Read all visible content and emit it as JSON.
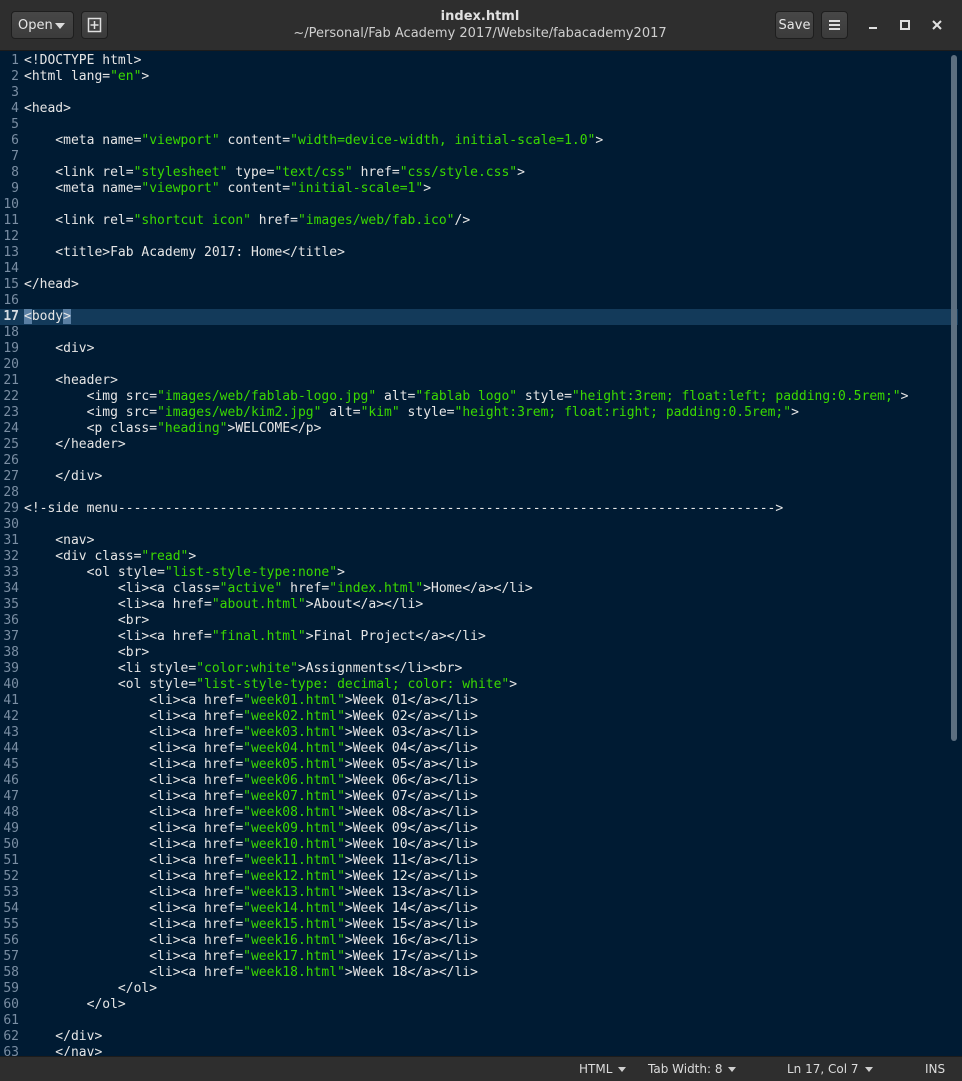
{
  "titlebar": {
    "open_label": "Open",
    "save_label": "Save",
    "title": "index.html",
    "subtitle": "~/Personal/Fab Academy 2017/Website/fabacademy2017",
    "icons": [
      "new-document-icon",
      "hamburger-menu-icon",
      "minimize-icon",
      "maximize-icon",
      "close-icon"
    ]
  },
  "colors": {
    "background": "#001b33",
    "string": "#3ad900",
    "text": "#e6e6e6",
    "current_line": "#133a5a"
  },
  "editor": {
    "current_line": 17,
    "lines": [
      [
        [
          "t",
          "<!DOCTYPE html>"
        ]
      ],
      [
        [
          "t",
          "<html lang="
        ],
        [
          "s",
          "\"en\""
        ],
        [
          "t",
          ">"
        ]
      ],
      [],
      [
        [
          "t",
          "<head>"
        ]
      ],
      [],
      [
        [
          "t",
          "    <meta name="
        ],
        [
          "s",
          "\"viewport\""
        ],
        [
          "t",
          " content="
        ],
        [
          "s",
          "\"width=device-width, initial-scale=1.0\""
        ],
        [
          "t",
          ">"
        ]
      ],
      [],
      [
        [
          "t",
          "    <link rel="
        ],
        [
          "s",
          "\"stylesheet\""
        ],
        [
          "t",
          " type="
        ],
        [
          "s",
          "\"text/css\""
        ],
        [
          "t",
          " href="
        ],
        [
          "s",
          "\"css/style.css\""
        ],
        [
          "t",
          ">"
        ]
      ],
      [
        [
          "t",
          "    <meta name="
        ],
        [
          "s",
          "\"viewport\""
        ],
        [
          "t",
          " content="
        ],
        [
          "s",
          "\"initial-scale=1\""
        ],
        [
          "t",
          ">"
        ]
      ],
      [],
      [
        [
          "t",
          "    <link rel="
        ],
        [
          "s",
          "\"shortcut icon\""
        ],
        [
          "t",
          " href="
        ],
        [
          "s",
          "\"images/web/fab.ico\""
        ],
        [
          "t",
          "/>"
        ]
      ],
      [],
      [
        [
          "t",
          "    <title>Fab Academy 2017: Home</title>"
        ]
      ],
      [],
      [
        [
          "t",
          "</head>"
        ]
      ],
      [],
      [
        [
          "sel",
          "<"
        ],
        [
          "t",
          "body"
        ],
        [
          "sel",
          ">"
        ]
      ],
      [],
      [
        [
          "t",
          "    <div>"
        ]
      ],
      [],
      [
        [
          "t",
          "    <header>"
        ]
      ],
      [
        [
          "t",
          "        <img src="
        ],
        [
          "s",
          "\"images/web/fablab-logo.jpg\""
        ],
        [
          "t",
          " alt="
        ],
        [
          "s",
          "\"fablab logo\""
        ],
        [
          "t",
          " style="
        ],
        [
          "s",
          "\"height:3rem; float:left; padding:0.5rem;\""
        ],
        [
          "t",
          ">"
        ]
      ],
      [
        [
          "t",
          "        <img src="
        ],
        [
          "s",
          "\"images/web/kim2.jpg\""
        ],
        [
          "t",
          " alt="
        ],
        [
          "s",
          "\"kim\""
        ],
        [
          "t",
          " style="
        ],
        [
          "s",
          "\"height:3rem; float:right; padding:0.5rem;\""
        ],
        [
          "t",
          ">"
        ]
      ],
      [
        [
          "t",
          "        <p class="
        ],
        [
          "s",
          "\"heading\""
        ],
        [
          "t",
          ">WELCOME</p>"
        ]
      ],
      [
        [
          "t",
          "    </header>"
        ]
      ],
      [],
      [
        [
          "t",
          "    </div>"
        ]
      ],
      [],
      [
        [
          "t",
          "<!-side menu------------------------------------------------------------------------------------>"
        ]
      ],
      [],
      [
        [
          "t",
          "    <nav>"
        ]
      ],
      [
        [
          "t",
          "    <div class="
        ],
        [
          "s",
          "\"read\""
        ],
        [
          "t",
          ">"
        ]
      ],
      [
        [
          "t",
          "        <ol style="
        ],
        [
          "s",
          "\"list-style-type:none\""
        ],
        [
          "t",
          ">"
        ]
      ],
      [
        [
          "t",
          "            <li><a class="
        ],
        [
          "s",
          "\"active\""
        ],
        [
          "t",
          " href="
        ],
        [
          "s",
          "\"index.html\""
        ],
        [
          "t",
          ">Home</a></li>"
        ]
      ],
      [
        [
          "t",
          "            <li><a href="
        ],
        [
          "s",
          "\"about.html\""
        ],
        [
          "t",
          ">About</a></li>"
        ]
      ],
      [
        [
          "t",
          "            <br>"
        ]
      ],
      [
        [
          "t",
          "            <li><a href="
        ],
        [
          "s",
          "\"final.html\""
        ],
        [
          "t",
          ">Final Project</a></li>"
        ]
      ],
      [
        [
          "t",
          "            <br>"
        ]
      ],
      [
        [
          "t",
          "            <li style="
        ],
        [
          "s",
          "\"color:white\""
        ],
        [
          "t",
          ">Assignments</li><br>"
        ]
      ],
      [
        [
          "t",
          "            <ol style="
        ],
        [
          "s",
          "\"list-style-type: decimal; color: white\""
        ],
        [
          "t",
          ">"
        ]
      ],
      [
        [
          "t",
          "                <li><a href="
        ],
        [
          "s",
          "\"week01.html\""
        ],
        [
          "t",
          ">Week 01</a></li>"
        ]
      ],
      [
        [
          "t",
          "                <li><a href="
        ],
        [
          "s",
          "\"week02.html\""
        ],
        [
          "t",
          ">Week 02</a></li>"
        ]
      ],
      [
        [
          "t",
          "                <li><a href="
        ],
        [
          "s",
          "\"week03.html\""
        ],
        [
          "t",
          ">Week 03</a></li>"
        ]
      ],
      [
        [
          "t",
          "                <li><a href="
        ],
        [
          "s",
          "\"week04.html\""
        ],
        [
          "t",
          ">Week 04</a></li>"
        ]
      ],
      [
        [
          "t",
          "                <li><a href="
        ],
        [
          "s",
          "\"week05.html\""
        ],
        [
          "t",
          ">Week 05</a></li>"
        ]
      ],
      [
        [
          "t",
          "                <li><a href="
        ],
        [
          "s",
          "\"week06.html\""
        ],
        [
          "t",
          ">Week 06</a></li>"
        ]
      ],
      [
        [
          "t",
          "                <li><a href="
        ],
        [
          "s",
          "\"week07.html\""
        ],
        [
          "t",
          ">Week 07</a></li>"
        ]
      ],
      [
        [
          "t",
          "                <li><a href="
        ],
        [
          "s",
          "\"week08.html\""
        ],
        [
          "t",
          ">Week 08</a></li>"
        ]
      ],
      [
        [
          "t",
          "                <li><a href="
        ],
        [
          "s",
          "\"week09.html\""
        ],
        [
          "t",
          ">Week 09</a></li>"
        ]
      ],
      [
        [
          "t",
          "                <li><a href="
        ],
        [
          "s",
          "\"week10.html\""
        ],
        [
          "t",
          ">Week 10</a></li>"
        ]
      ],
      [
        [
          "t",
          "                <li><a href="
        ],
        [
          "s",
          "\"week11.html\""
        ],
        [
          "t",
          ">Week 11</a></li>"
        ]
      ],
      [
        [
          "t",
          "                <li><a href="
        ],
        [
          "s",
          "\"week12.html\""
        ],
        [
          "t",
          ">Week 12</a></li>"
        ]
      ],
      [
        [
          "t",
          "                <li><a href="
        ],
        [
          "s",
          "\"week13.html\""
        ],
        [
          "t",
          ">Week 13</a></li>"
        ]
      ],
      [
        [
          "t",
          "                <li><a href="
        ],
        [
          "s",
          "\"week14.html\""
        ],
        [
          "t",
          ">Week 14</a></li>"
        ]
      ],
      [
        [
          "t",
          "                <li><a href="
        ],
        [
          "s",
          "\"week15.html\""
        ],
        [
          "t",
          ">Week 15</a></li>"
        ]
      ],
      [
        [
          "t",
          "                <li><a href="
        ],
        [
          "s",
          "\"week16.html\""
        ],
        [
          "t",
          ">Week 16</a></li>"
        ]
      ],
      [
        [
          "t",
          "                <li><a href="
        ],
        [
          "s",
          "\"week17.html\""
        ],
        [
          "t",
          ">Week 17</a></li>"
        ]
      ],
      [
        [
          "t",
          "                <li><a href="
        ],
        [
          "s",
          "\"week18.html\""
        ],
        [
          "t",
          ">Week 18</a></li>"
        ]
      ],
      [
        [
          "t",
          "            </ol>"
        ]
      ],
      [
        [
          "t",
          "        </ol>"
        ]
      ],
      [],
      [
        [
          "t",
          "    </div>"
        ]
      ],
      [
        [
          "t",
          "    </nav>"
        ]
      ]
    ]
  },
  "statusbar": {
    "language": "HTML",
    "tab_width": "Tab Width: 8",
    "position": "Ln 17, Col 7",
    "mode": "INS"
  }
}
